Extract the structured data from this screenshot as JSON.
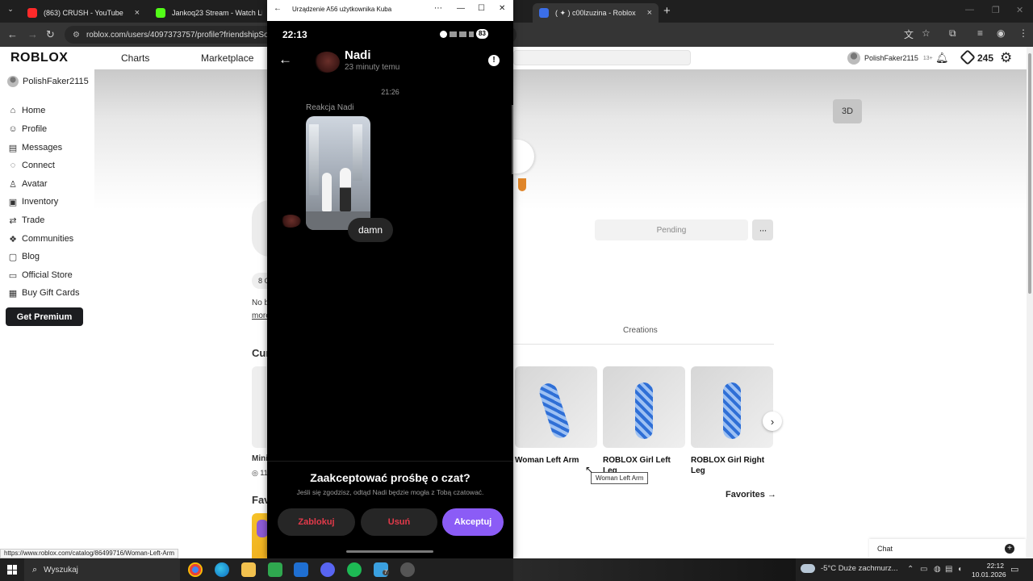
{
  "browser": {
    "tabs": [
      {
        "label": "(863) CRUSH - YouTube",
        "color": "#ff2a2a"
      },
      {
        "label": "Jankoq23 Stream - Watch Live",
        "color": "#53fc18"
      },
      {
        "label": "( ✦ ) c00lzuzina - Roblox",
        "color": "#3b6ee8"
      }
    ],
    "url": "roblox.com/users/4097373757/profile?friendshipSource"
  },
  "roblox": {
    "logo": "ROBLOX",
    "nav": {
      "charts": "Charts",
      "marketplace": "Marketplace"
    },
    "user": {
      "name": "PolishFaker2115",
      "age_tag": "13+"
    },
    "robux": "245",
    "sidebar": {
      "username": "PolishFaker2115",
      "items": [
        {
          "label": "Home",
          "icon": "⌂"
        },
        {
          "label": "Profile",
          "icon": "☺"
        },
        {
          "label": "Messages",
          "icon": "▤"
        },
        {
          "label": "Connect",
          "icon": "◌"
        },
        {
          "label": "Avatar",
          "icon": "♙"
        },
        {
          "label": "Inventory",
          "icon": "▣"
        },
        {
          "label": "Trade",
          "icon": "⇄"
        },
        {
          "label": "Communities",
          "icon": "❖"
        },
        {
          "label": "Blog",
          "icon": "▢"
        },
        {
          "label": "Official Store",
          "icon": "▭"
        },
        {
          "label": "Buy Gift Cards",
          "icon": "▦"
        }
      ],
      "premium": "Get Premium"
    },
    "profile": {
      "btn_3d": "3D",
      "pending": "Pending",
      "more": "···",
      "fragments": {
        "friends": "8 C",
        "no_b": "No b",
        "more": "more",
        "cur": "Cur",
        "mini": "Mini",
        "price": "◎ 11",
        "fav": "Fav"
      }
    },
    "creations_tab": "Creations",
    "items": [
      {
        "name": "Woman Left Arm"
      },
      {
        "name": "ROBLOX Girl Left Leg"
      },
      {
        "name": "ROBLOX Girl Right Leg"
      }
    ],
    "tooltip": "Woman Left Arm",
    "favorites": "Favorites →",
    "chat": "Chat",
    "status_url": "https://www.roblox.com/catalog/86499716/Woman-Left-Arm"
  },
  "phone": {
    "window_title": "Urządzenie A56 użytkownika Kuba",
    "status": {
      "time": "22:13",
      "battery": "83"
    },
    "chat": {
      "name": "Nadi",
      "subtitle": "23 minuty temu",
      "timestamp": "21:26",
      "reaction_label": "Reakcja Nadi",
      "message": "damn"
    },
    "request": {
      "title": "Zaakceptować prośbę o czat?",
      "subtitle": "Jeśli się zgodzisz, odtąd Nadi będzie mogła z Tobą czatować.",
      "block": "Zablokuj",
      "delete": "Usuń",
      "accept": "Akceptuj"
    }
  },
  "taskbar": {
    "search": "Wyszukaj",
    "badge": "7",
    "weather": "-5°C  Duże zachmurz...",
    "time": "22:12",
    "date": "10.01.2026"
  }
}
